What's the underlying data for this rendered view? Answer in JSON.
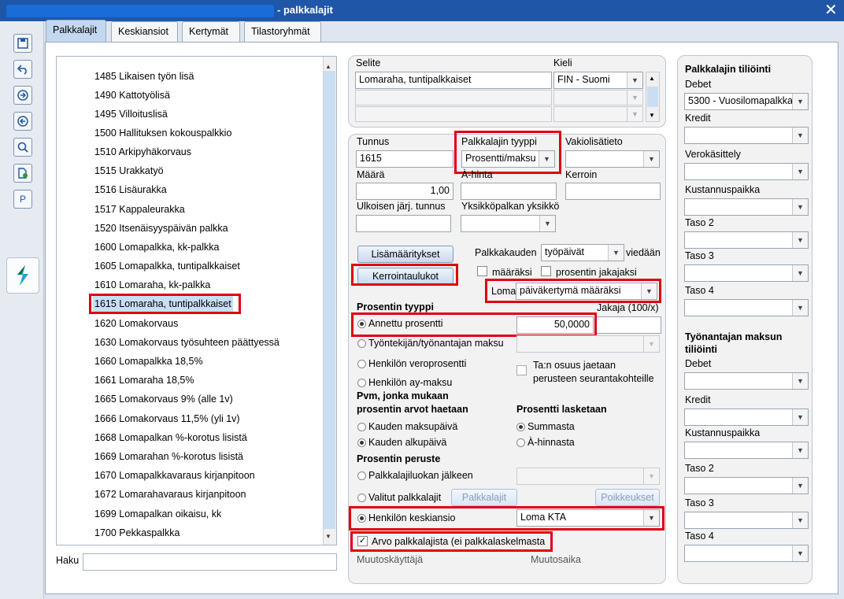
{
  "window": {
    "title": "- palkkalajit",
    "close_icon": "✕"
  },
  "tabs": [
    {
      "label": "Palkkalajit",
      "active": true
    },
    {
      "label": "Keskiansiot",
      "active": false
    },
    {
      "label": "Kertymät",
      "active": false
    },
    {
      "label": "Tilastoryhmät",
      "active": false
    }
  ],
  "toolbar": {
    "p_label": "P"
  },
  "list": {
    "items": [
      "1485 Likaisen työn lisä",
      "1490 Kattotyölisä",
      "1495 Villoituslisä",
      "1500 Hallituksen kokouspalkkio",
      "1510 Arkipyhäkorvaus",
      "1515 Urakkatyö",
      "1516 Lisäurakka",
      "1517 Kappaleurakka",
      "1520 Itsenäisyyspäivän palkka",
      "1600 Lomapalkka, kk-palkka",
      "1605 Lomapalkka, tuntipalkkaiset",
      "1610 Lomaraha, kk-palkka",
      "1615 Lomaraha, tuntipalkkaiset",
      "1620 Lomakorvaus",
      "1630 Lomakorvaus työsuhteen päättyessä",
      "1660 Lomapalkka 18,5%",
      "1661 Lomaraha 18,5%",
      "1665 Lomakorvaus 9% (alle 1v)",
      "1666 Lomakorvaus 11,5% (yli 1v)",
      "1668 Lomapalkan %-korotus lisistä",
      "1669 Lomarahan %-korotus lisistä",
      "1670 Lomapalkkavaraus kirjanpitoon",
      "1672 Lomarahavaraus kirjanpitoon",
      "1699 Lomapalkan oikaisu, kk",
      "1700 Pekkaspalkka"
    ],
    "selected_index": 12,
    "search_label": "Haku",
    "search_value": ""
  },
  "selite": {
    "label_selite": "Selite",
    "label_kieli": "Kieli",
    "rows": [
      {
        "text": "Lomaraha, tuntipalkkaiset",
        "lang": "FIN - Suomi"
      },
      {
        "text": "",
        "lang": ""
      },
      {
        "text": "",
        "lang": ""
      }
    ]
  },
  "form": {
    "tunnus_label": "Tunnus",
    "tunnus_value": "1615",
    "tyyppi_label": "Palkkalajin tyyppi",
    "tyyppi_value": "Prosentti/maksu",
    "vakio_label": "Vakiolisätieto",
    "vakio_value": "",
    "maara_label": "Määrä",
    "maara_value": "1,00",
    "ahinta_label": "À-hinta",
    "ahinta_value": "",
    "kerroin_label": "Kerroin",
    "kerroin_value": "",
    "ulkoinen_label": "Ulkoisen järj. tunnus",
    "ulkoinen_value": "",
    "yksikko_label": "Yksikköpalkan yksikkö",
    "yksikko_value": "",
    "lisamaaritykset_button": "Lisämääritykset",
    "kerrointaulukot_button": "Kerrointaulukot",
    "palkkakauden_label": "Palkkakauden",
    "tyopaivat_value": "työpäivät",
    "viedaan_label": "viedään",
    "maaraksi_label": "määräksi",
    "jakajaksi_label": "prosentin jakajaksi",
    "loma_label": "Loma",
    "loma_value": "päiväkertymä määräksi",
    "prosentin_tyyppi_label": "Prosentin tyyppi",
    "jakaja_label": "Jakaja (100/x)",
    "annettu_label": "Annettu prosentti",
    "annettu_value": "50,0000",
    "tt_maksu_label": "Työntekijän/työnantajan maksu",
    "veroprosentti_label": "Henkilön veroprosentti",
    "ta_osuus_label_1": "Ta:n osuus jaetaan",
    "ta_osuus_label_2": "perusteen seurantakohteille",
    "ay_maksu_label": "Henkilön ay-maksu",
    "pvm_label_1": "Pvm, jonka mukaan",
    "pvm_label_2": "prosentin arvot haetaan",
    "lasketaan_label": "Prosentti lasketaan",
    "maksupaiva_label": "Kauden maksupäivä",
    "alkupaiva_label": "Kauden alkupäivä",
    "summasta_label": "Summasta",
    "ahinnasta_label": "À-hinnasta",
    "peruste_label": "Prosentin peruste",
    "jalkeen_label": "Palkkalajiluokan jälkeen",
    "valitut_label": "Valitut palkkalajit",
    "palkkalajit_button": "Palkkalajit",
    "poikkeukset_button": "Poikkeukset",
    "keskiansio_label": "Henkilön keskiansio",
    "keskiansio_value": "Loma KTA",
    "arvo_label": "Arvo palkkalajista (ei palkkalaskelmasta",
    "muutoskayttaja_label": "Muutoskäyttäjä",
    "muutosaika_label": "Muutosaika"
  },
  "tiliointi": {
    "title": "Palkkalajin tiliöinti",
    "debet_label": "Debet",
    "debet_value": "5300 - Vuosilomapalkka",
    "kredit_label": "Kredit",
    "verokasittely_label": "Verokäsittely",
    "kustannuspaikka_label": "Kustannuspaikka",
    "taso2_label": "Taso 2",
    "taso3_label": "Taso 3",
    "taso4_label": "Taso 4",
    "tyonantaja_title_1": "Työnantajan maksun",
    "tyonantaja_title_2": "tiliöinti",
    "ta_debet_label": "Debet",
    "ta_kredit_label": "Kredit",
    "ta_kustannuspaikka_label": "Kustannuspaikka",
    "ta_taso2_label": "Taso 2",
    "ta_taso3_label": "Taso 3",
    "ta_taso4_label": "Taso 4"
  }
}
